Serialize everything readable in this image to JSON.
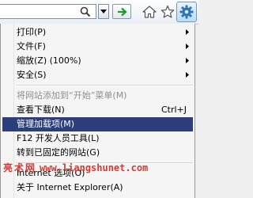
{
  "toolbar": {
    "icons": [
      "search-icon",
      "chevron-down-icon",
      "go-arrow-icon",
      "home-icon",
      "favorites-star-icon",
      "gear-icon"
    ],
    "colors": {
      "go_arrow": "#1f9a2f",
      "gear": "#2e74b6"
    }
  },
  "menu": {
    "items": [
      {
        "label": "打印(P)",
        "submenu": true
      },
      {
        "label": "文件(F)",
        "submenu": true
      },
      {
        "label": "缩放(Z) (100%)",
        "submenu": true
      },
      {
        "label": "安全(S)",
        "submenu": true
      },
      {
        "label": "将网站添加到“开始”菜单(M)",
        "disabled": true
      },
      {
        "label": "查看下载(N)",
        "shortcut": "Ctrl+J"
      },
      {
        "label": "管理加载项(M)",
        "highlighted": true
      },
      {
        "label": "F12 开发人员工具(L)"
      },
      {
        "label": "转到已固定的网站(G)"
      },
      {
        "label": "Internet 选项(O)"
      },
      {
        "label": "关于 Internet Explorer(A)"
      }
    ],
    "highlight_color": "#2c3f7c"
  },
  "watermark": {
    "brand": "亮术网",
    "url": "www.liangshunet.com",
    "color": "#d83a32"
  }
}
